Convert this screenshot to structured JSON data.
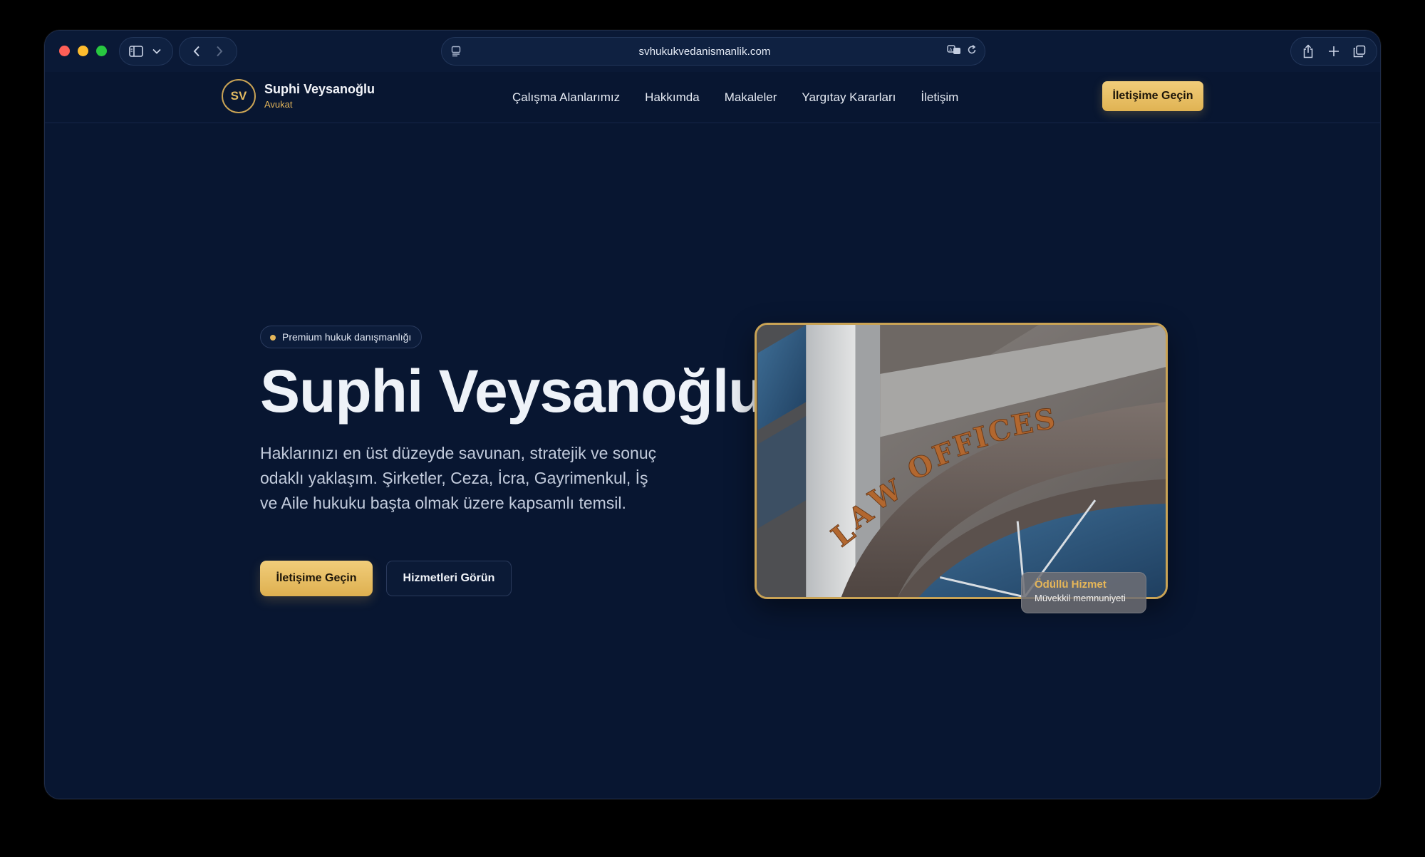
{
  "browser": {
    "url": "svhukukvedanismanlik.com"
  },
  "brand": {
    "initials": "SV",
    "name": "Suphi Veysanoğlu",
    "subtitle": "Avukat"
  },
  "nav": {
    "items": [
      {
        "label": "Çalışma Alanlarımız"
      },
      {
        "label": "Hakkımda"
      },
      {
        "label": "Makaleler"
      },
      {
        "label": "Yargıtay Kararları"
      },
      {
        "label": "İletişim"
      }
    ],
    "cta_label": "İletişime Geçin"
  },
  "hero": {
    "badge": "Premium hukuk danışmanlığı",
    "title": "Suphi Veysanoğlu",
    "description": "Haklarınızı en üst düzeyde savunan, stratejik ve sonuç odaklı yaklaşım. Şirketler, Ceza, İcra, Gayrimenkul, İş ve Aile hukuku başta olmak üzere kapsamlı temsil.",
    "primary_button": "İletişime Geçin",
    "secondary_button": "Hizmetleri Görün",
    "image_sign_text": "LAW OFFICES",
    "award_title": "Ödüllü Hizmet",
    "award_subtitle": "Müvekkil memnuniyeti"
  },
  "colors": {
    "background": "#081631",
    "accent_gold": "#e3b55a",
    "text_primary": "#eef2f8"
  }
}
